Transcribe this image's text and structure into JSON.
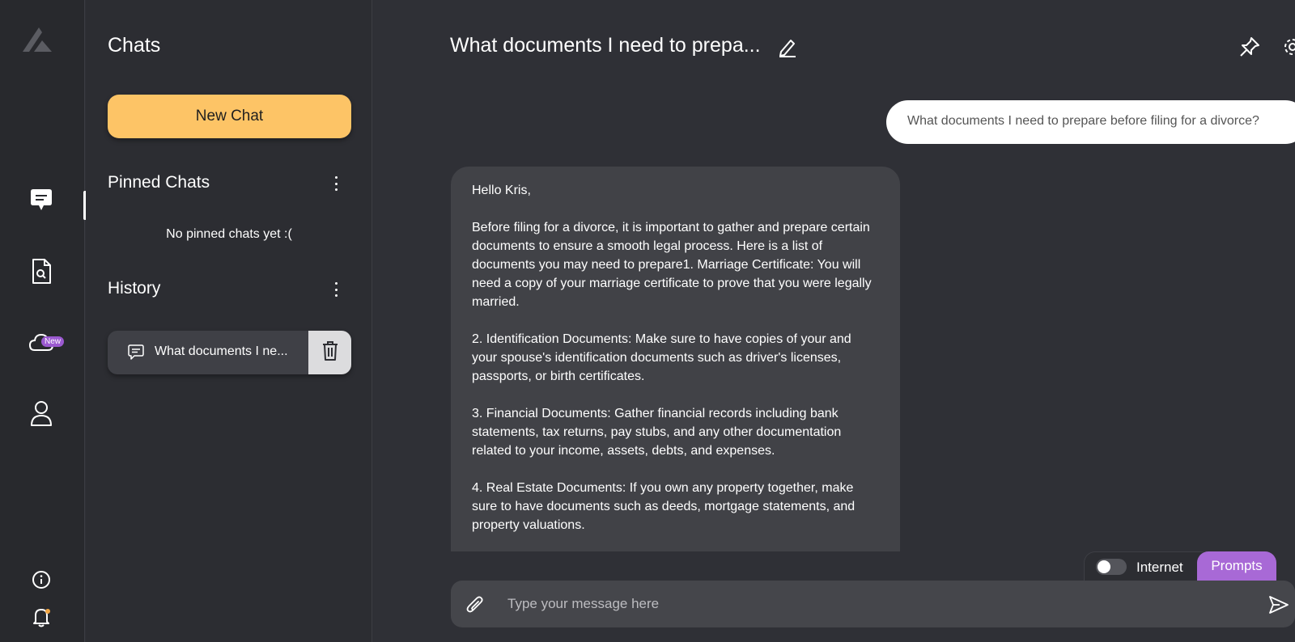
{
  "sidebar": {
    "nav": [
      {
        "icon": "chat-icon",
        "active": true
      },
      {
        "icon": "document-search-icon",
        "active": false
      },
      {
        "icon": "cloud-icon",
        "active": false,
        "badge": "New"
      },
      {
        "icon": "user-icon",
        "active": false
      }
    ],
    "bottom": [
      {
        "icon": "info-icon"
      },
      {
        "icon": "bell-icon"
      }
    ]
  },
  "panel": {
    "title": "Chats",
    "new_chat_label": "New Chat",
    "pinned_title": "Pinned Chats",
    "pinned_empty": "No pinned chats yet :(",
    "history_title": "History",
    "history_items": [
      {
        "label": "What documents I ne..."
      }
    ]
  },
  "chat": {
    "title": "What documents I need to prepa...",
    "user_message": "What documents I need to prepare before filing for a divorce?",
    "bot_message": [
      "Hello Kris,",
      "Before filing for a divorce, it is important to gather and prepare certain documents to ensure a smooth legal process. Here is a list of documents you may need to prepare1. Marriage Certificate: You will need a copy of your marriage certificate to prove that you were legally married.",
      "2. Identification Documents: Make sure to have copies of your and your spouse's identification documents such as driver's licenses, passports, or birth certificates.",
      "3. Financial Documents: Gather financial records including bank statements, tax returns, pay stubs, and any other documentation related to your income, assets, debts, and expenses.",
      "4. Real Estate Documents: If you own any property together, make sure to have documents such as deeds, mortgage statements, and property valuations."
    ]
  },
  "composer": {
    "internet_label": "Internet",
    "internet_enabled": false,
    "prompts_label": "Prompts",
    "placeholder": "Type your message here"
  },
  "colors": {
    "accent": "#fdc466",
    "prompts": "#a869d6",
    "badge": "#9b59d0",
    "background": "#2f3036"
  }
}
